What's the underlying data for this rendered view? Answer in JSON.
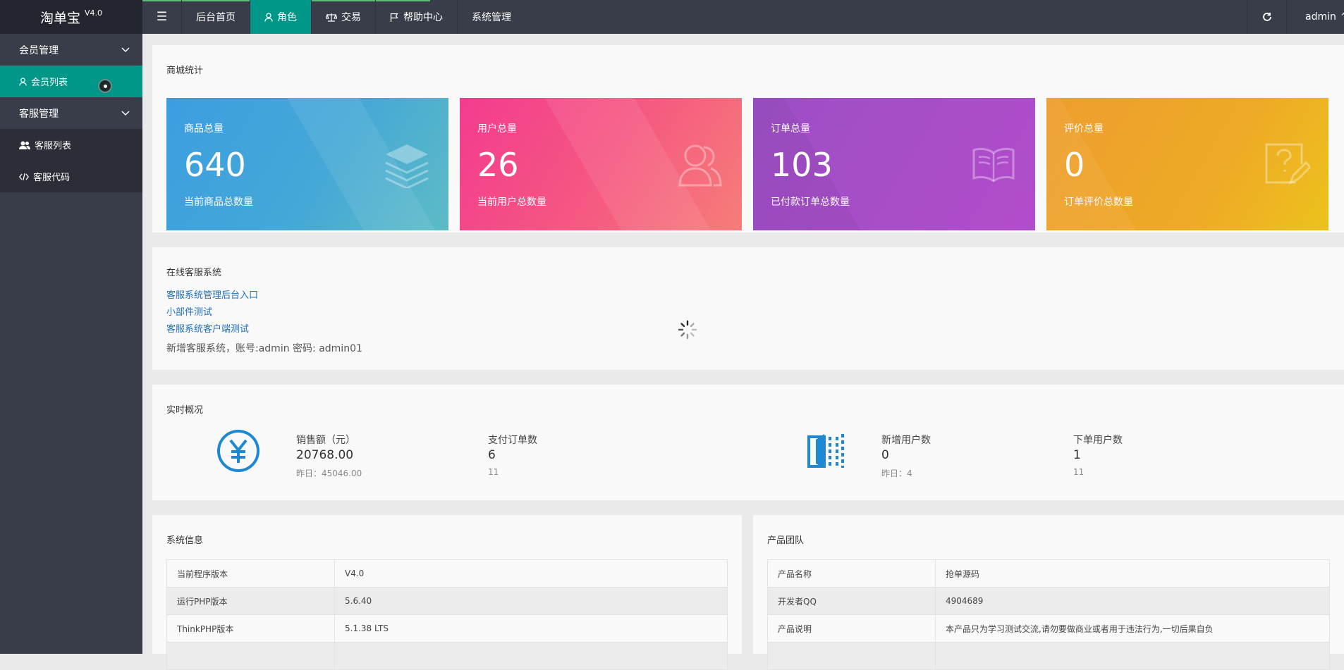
{
  "app": {
    "logo": "淘单宝",
    "version": "V4.0"
  },
  "topnav": {
    "items": [
      {
        "label": "后台首页",
        "icon": ""
      },
      {
        "label": "角色",
        "icon": "user-icon"
      },
      {
        "label": "交易",
        "icon": "balance-icon"
      },
      {
        "label": "帮助中心",
        "icon": "flag-icon"
      },
      {
        "label": "系统管理",
        "icon": ""
      }
    ],
    "user": "admin"
  },
  "sidebar": {
    "groups": [
      {
        "label": "会员管理",
        "items": [
          {
            "label": "会员列表",
            "icon": "user-icon"
          }
        ]
      },
      {
        "label": "客服管理",
        "items": [
          {
            "label": "客服列表",
            "icon": "users-icon"
          },
          {
            "label": "客服代码",
            "icon": "code-icon"
          }
        ]
      }
    ]
  },
  "stats_panel": {
    "title": "商城统计",
    "cards": [
      {
        "title": "商品总量",
        "value": "640",
        "sub": "当前商品总数量",
        "icon": "layers-icon",
        "color": "#3aa3d9"
      },
      {
        "title": "用户总量",
        "value": "26",
        "sub": "当前用户总数量",
        "icon": "users-icon",
        "color": "#f5468c"
      },
      {
        "title": "订单总量",
        "value": "103",
        "sub": "已付款订单总数量",
        "icon": "book-icon",
        "color": "#a54dc7"
      },
      {
        "title": "评价总量",
        "value": "0",
        "sub": "订单评价总数量",
        "icon": "question-doc-icon",
        "color": "#eea82a"
      }
    ]
  },
  "service_panel": {
    "title": "在线客服系统",
    "links": [
      "客服系统管理后台入口",
      "小部件测试",
      "客服系统客户端测试"
    ],
    "note": "新增客服系统，账号:admin 密码: admin01"
  },
  "realtime_panel": {
    "title": "实时概况",
    "left": [
      {
        "label": "销售额（元）",
        "value": "20768.00",
        "sub": "昨日：45046.00"
      },
      {
        "label": "支付订单数",
        "value": "6",
        "sub": "11"
      }
    ],
    "right": [
      {
        "label": "新增用户数",
        "value": "0",
        "sub": "昨日：4"
      },
      {
        "label": "下单用户数",
        "value": "1",
        "sub": "11"
      }
    ]
  },
  "sysinfo_panel": {
    "title": "系统信息",
    "rows": [
      [
        "当前程序版本",
        "V4.0"
      ],
      [
        "运行PHP版本",
        "5.6.40"
      ],
      [
        "ThinkPHP版本",
        "5.1.38 LTS"
      ],
      [
        "",
        ""
      ]
    ]
  },
  "team_panel": {
    "title": "产品团队",
    "rows": [
      [
        "产品名称",
        "抢单源码"
      ],
      [
        "开发者QQ",
        "4904689"
      ],
      [
        "产品说明",
        "本产品只为学习测试交流,请勿要做商业或者用于违法行为,一切后果自负"
      ],
      [
        "",
        ""
      ]
    ]
  }
}
